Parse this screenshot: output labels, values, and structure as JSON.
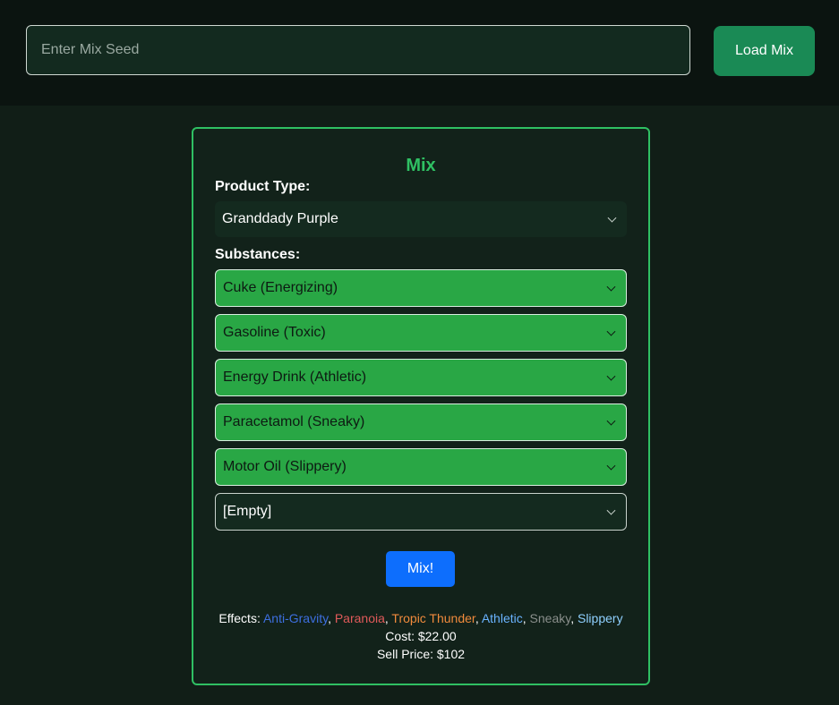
{
  "seed_input": {
    "placeholder": "Enter Mix Seed",
    "value": ""
  },
  "load_button": "Load Mix",
  "panel": {
    "title": "Mix",
    "product_type_label": "Product Type:",
    "product_type_value": "Granddady Purple",
    "substances_label": "Substances:",
    "substances": [
      "Cuke (Energizing)",
      "Gasoline (Toxic)",
      "Energy Drink (Athletic)",
      "Paracetamol (Sneaky)",
      "Motor Oil (Slippery)",
      "[Empty]"
    ],
    "mix_button": "Mix!",
    "effects_label": "Effects:",
    "effects": [
      {
        "name": "Anti-Gravity",
        "color": "#3d6fe0"
      },
      {
        "name": "Paranoia",
        "color": "#e05a5a"
      },
      {
        "name": "Tropic Thunder",
        "color": "#f08a3c"
      },
      {
        "name": "Athletic",
        "color": "#6ab3ff"
      },
      {
        "name": "Sneaky",
        "color": "#8a8f8c"
      },
      {
        "name": "Slippery",
        "color": "#8fd0ff"
      }
    ],
    "cost": "Cost: $22.00",
    "sell_price": "Sell Price: $102"
  },
  "colors": {
    "accent_green": "#2fc063",
    "substance_fill": "#29a745",
    "load_button": "#1a8a55",
    "mix_button": "#0d6efd"
  }
}
